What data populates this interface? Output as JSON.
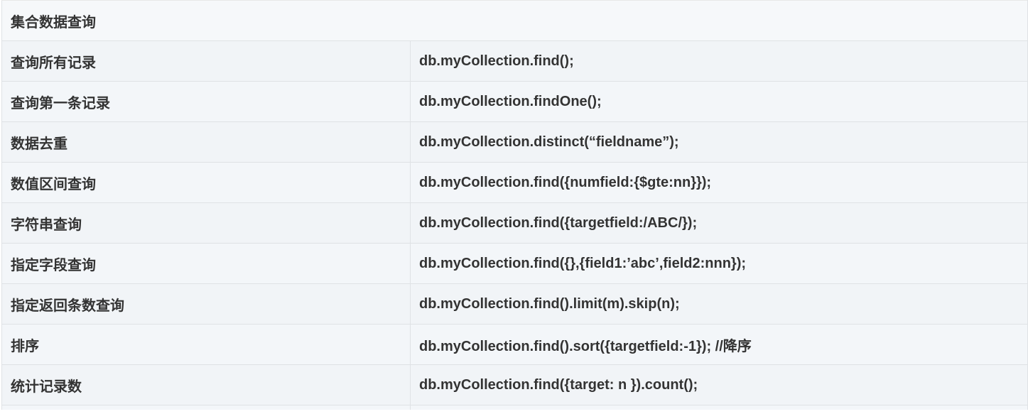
{
  "table": {
    "header": "集合数据查询",
    "rows": [
      {
        "label": "查询所有记录",
        "code": "db.myCollection.find();"
      },
      {
        "label": "查询第一条记录",
        "code": "db.myCollection.findOne();"
      },
      {
        "label": "数据去重",
        "code": "db.myCollection.distinct(“fieldname”);"
      },
      {
        "label": "数值区间查询",
        "code": "db.myCollection.find({numfield:{$gte:nn}});"
      },
      {
        "label": "字符串查询",
        "code": "db.myCollection.find({targetfield:/ABC/});"
      },
      {
        "label": "指定字段查询",
        "code": "db.myCollection.find({},{field1:’abc’,field2:nnn});"
      },
      {
        "label": "指定返回条数查询",
        "code": "db.myCollection.find().limit(m).skip(n);"
      },
      {
        "label": "排序",
        "code": "db.myCollection.find().sort({targetfield:-1}); //降序"
      },
      {
        "label": "统计记录数",
        "code": "db.myCollection.find({target: n }).count();"
      }
    ]
  }
}
